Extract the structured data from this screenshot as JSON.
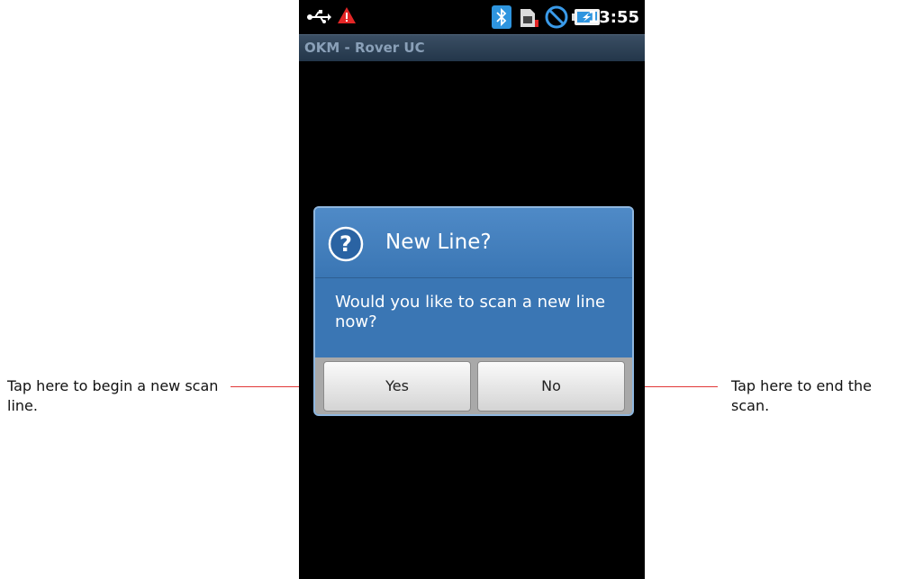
{
  "status_bar": {
    "time": "13:55",
    "icons": [
      "usb-icon",
      "warning-icon",
      "bluetooth-icon",
      "sim-icon",
      "no-signal-icon",
      "battery-charging-icon"
    ]
  },
  "app": {
    "title": "OKM - Rover UC"
  },
  "dialog": {
    "title": "New Line?",
    "message": "Would you like to scan a new line now?",
    "icon": "question-icon",
    "buttons": {
      "yes": "Yes",
      "no": "No"
    }
  },
  "annotations": {
    "left": "Tap here to begin a new scan line.",
    "right": "Tap here to end the scan."
  },
  "colors": {
    "leader_line": "#e23838",
    "dialog_bg": "#3a76b4",
    "title_bar": "#2c4157"
  }
}
